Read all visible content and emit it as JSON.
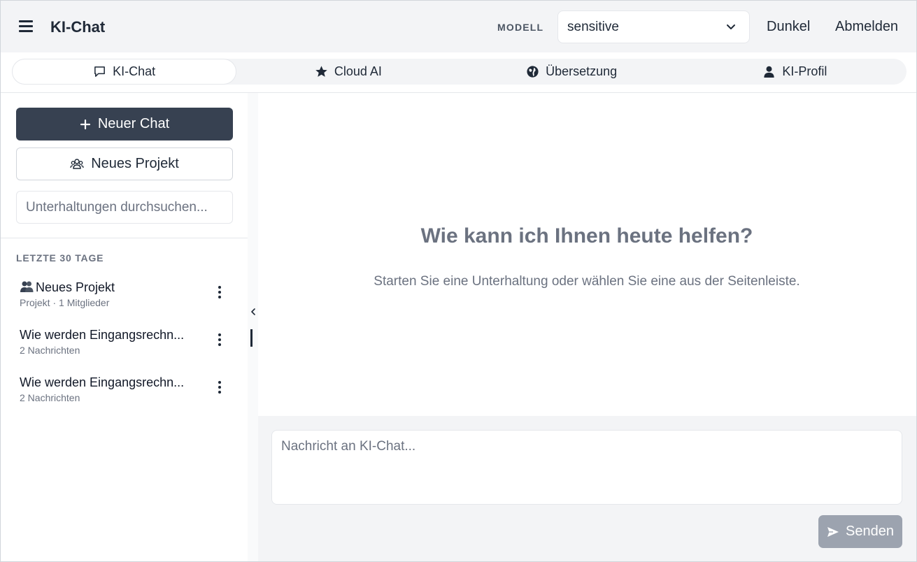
{
  "header": {
    "title": "KI-Chat",
    "model_label": "MODELL",
    "model_value": "sensitive",
    "theme_link": "Dunkel",
    "logout_link": "Abmelden"
  },
  "tabs": [
    {
      "label": "KI-Chat",
      "icon": "chat-bubble-icon",
      "active": true
    },
    {
      "label": "Cloud AI",
      "icon": "star-icon",
      "active": false
    },
    {
      "label": "Übersetzung",
      "icon": "globe-icon",
      "active": false
    },
    {
      "label": "KI-Profil",
      "icon": "user-icon",
      "active": false
    }
  ],
  "sidebar": {
    "new_chat": "Neuer Chat",
    "new_project": "Neues Projekt",
    "search_placeholder": "Unterhaltungen durchsuchen...",
    "section_label": "LETZTE 30 TAGE",
    "conversations": [
      {
        "title": "Neues Projekt",
        "subtitle": "Projekt · 1 Mitglieder",
        "icon": "project-people-icon"
      },
      {
        "title": "Wie werden Eingangsrechn...",
        "subtitle": "2 Nachrichten"
      },
      {
        "title": "Wie werden Eingangsrechn...",
        "subtitle": "2 Nachrichten"
      }
    ]
  },
  "main": {
    "welcome_title": "Wie kann ich Ihnen heute helfen?",
    "welcome_subtitle": "Starten Sie eine Unterhaltung oder wählen Sie eine aus der Seitenleiste."
  },
  "composer": {
    "placeholder": "Nachricht an KI-Chat...",
    "send_label": "Senden"
  },
  "colors": {
    "header_bg": "#f3f4f6",
    "primary_button": "#374151",
    "send_button": "#9ca3af",
    "muted_text": "#6b7280"
  }
}
